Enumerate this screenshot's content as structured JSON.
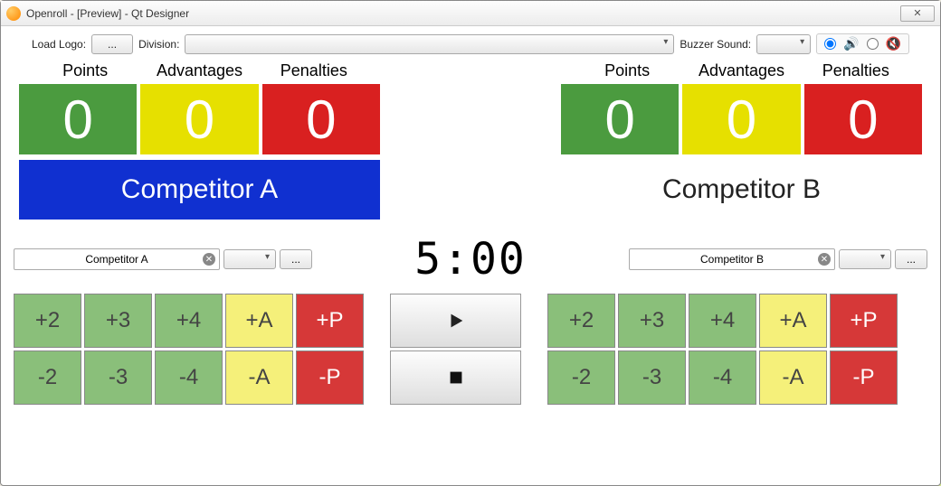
{
  "window": {
    "title": "Openroll - [Preview] - Qt Designer"
  },
  "toolbar": {
    "load_logo_label": "Load Logo:",
    "load_logo_button": "...",
    "division_label": "Division:",
    "buzzer_label": "Buzzer Sound:"
  },
  "headers": {
    "points": "Points",
    "advantages": "Advantages",
    "penalties": "Penalties"
  },
  "competitorA": {
    "name": "Competitor A",
    "points": "0",
    "advantages": "0",
    "penalties": "0",
    "input_value": "Competitor A"
  },
  "competitorB": {
    "name": "Competitor B",
    "points": "0",
    "advantages": "0",
    "penalties": "0",
    "input_value": "Competitor B"
  },
  "timer": "5:00",
  "buttons": {
    "plus2": "+2",
    "plus3": "+3",
    "plus4": "+4",
    "plusA": "+A",
    "plusP": "+P",
    "minus2": "-2",
    "minus3": "-3",
    "minus4": "-4",
    "minusA": "-A",
    "minusP": "-P",
    "browse": "..."
  }
}
